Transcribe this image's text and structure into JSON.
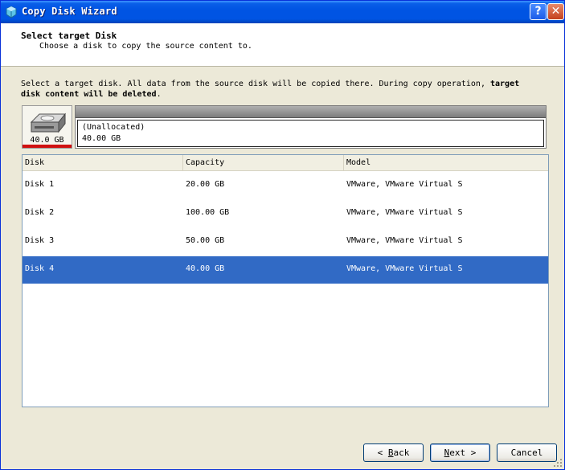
{
  "window": {
    "title": "Copy Disk Wizard",
    "help_glyph": "?",
    "close_glyph": "✕"
  },
  "header": {
    "title": "Select target Disk",
    "subtitle": "Choose a disk to copy the source content to."
  },
  "instruction": {
    "text_1": "Select a target disk. All data from the source disk will be copied there. During copy operation, ",
    "bold": "target disk content will be deleted",
    "text_2": "."
  },
  "selected_disk": {
    "size_label": "40.0 GB",
    "partition_name": "(Unallocated)",
    "partition_size": "40.00 GB"
  },
  "table": {
    "columns": [
      "Disk",
      "Capacity",
      "Model"
    ],
    "rows": [
      {
        "disk": "Disk 1",
        "capacity": "20.00 GB",
        "model": "VMware, VMware Virtual S"
      },
      {
        "disk": "Disk 2",
        "capacity": "100.00 GB",
        "model": "VMware, VMware Virtual S"
      },
      {
        "disk": "Disk 3",
        "capacity": "50.00 GB",
        "model": "VMware, VMware Virtual S"
      },
      {
        "disk": "Disk 4",
        "capacity": "40.00 GB",
        "model": "VMware, VMware Virtual S"
      }
    ],
    "selected_index": 3
  },
  "buttons": {
    "back": {
      "mnemonic": "B",
      "rest": "ack",
      "prefix": "< "
    },
    "next": {
      "mnemonic": "N",
      "rest": "ext",
      "suffix": " >"
    },
    "cancel": "Cancel"
  },
  "colors": {
    "titlebar": "#0054e3",
    "selection": "#316ac5",
    "window_bg": "#ece9d8"
  }
}
